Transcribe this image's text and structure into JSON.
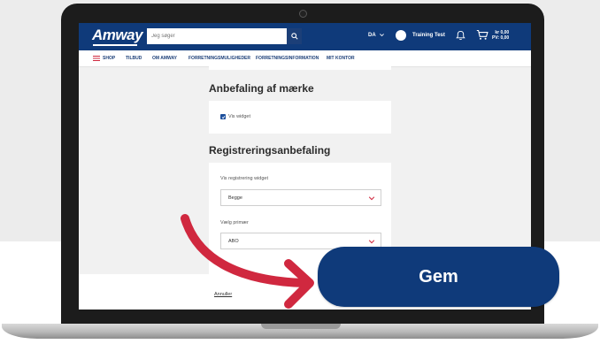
{
  "header": {
    "logo": "Amway",
    "search_placeholder": "Jeg søger",
    "language": "DA",
    "user_name": "Training Test",
    "cart_amount": "kr 0,00",
    "cart_pv": "PV: 0,00"
  },
  "nav": {
    "items": [
      "SHOP",
      "TILBUD",
      "OM AMWAY",
      "FORRETNINGSMULIGHEDER",
      "FORRETNINGSINFORMATION",
      "MIT KONTOR"
    ]
  },
  "brand_recommendation": {
    "title": "Anbefaling af mærke",
    "checkbox_label": "Vis widget",
    "checked": true
  },
  "registration_recommendation": {
    "title": "Registreringsanbefaling",
    "field1_label": "Vis registrering widget",
    "field1_value": "Begge",
    "field2_label": "Vælg primær",
    "field2_value": "ABO"
  },
  "actions": {
    "cancel_label": "Annuller",
    "save_label": "Gem"
  },
  "colors": {
    "brand_blue": "#0f3a7a",
    "arrow_red": "#d0283f"
  }
}
